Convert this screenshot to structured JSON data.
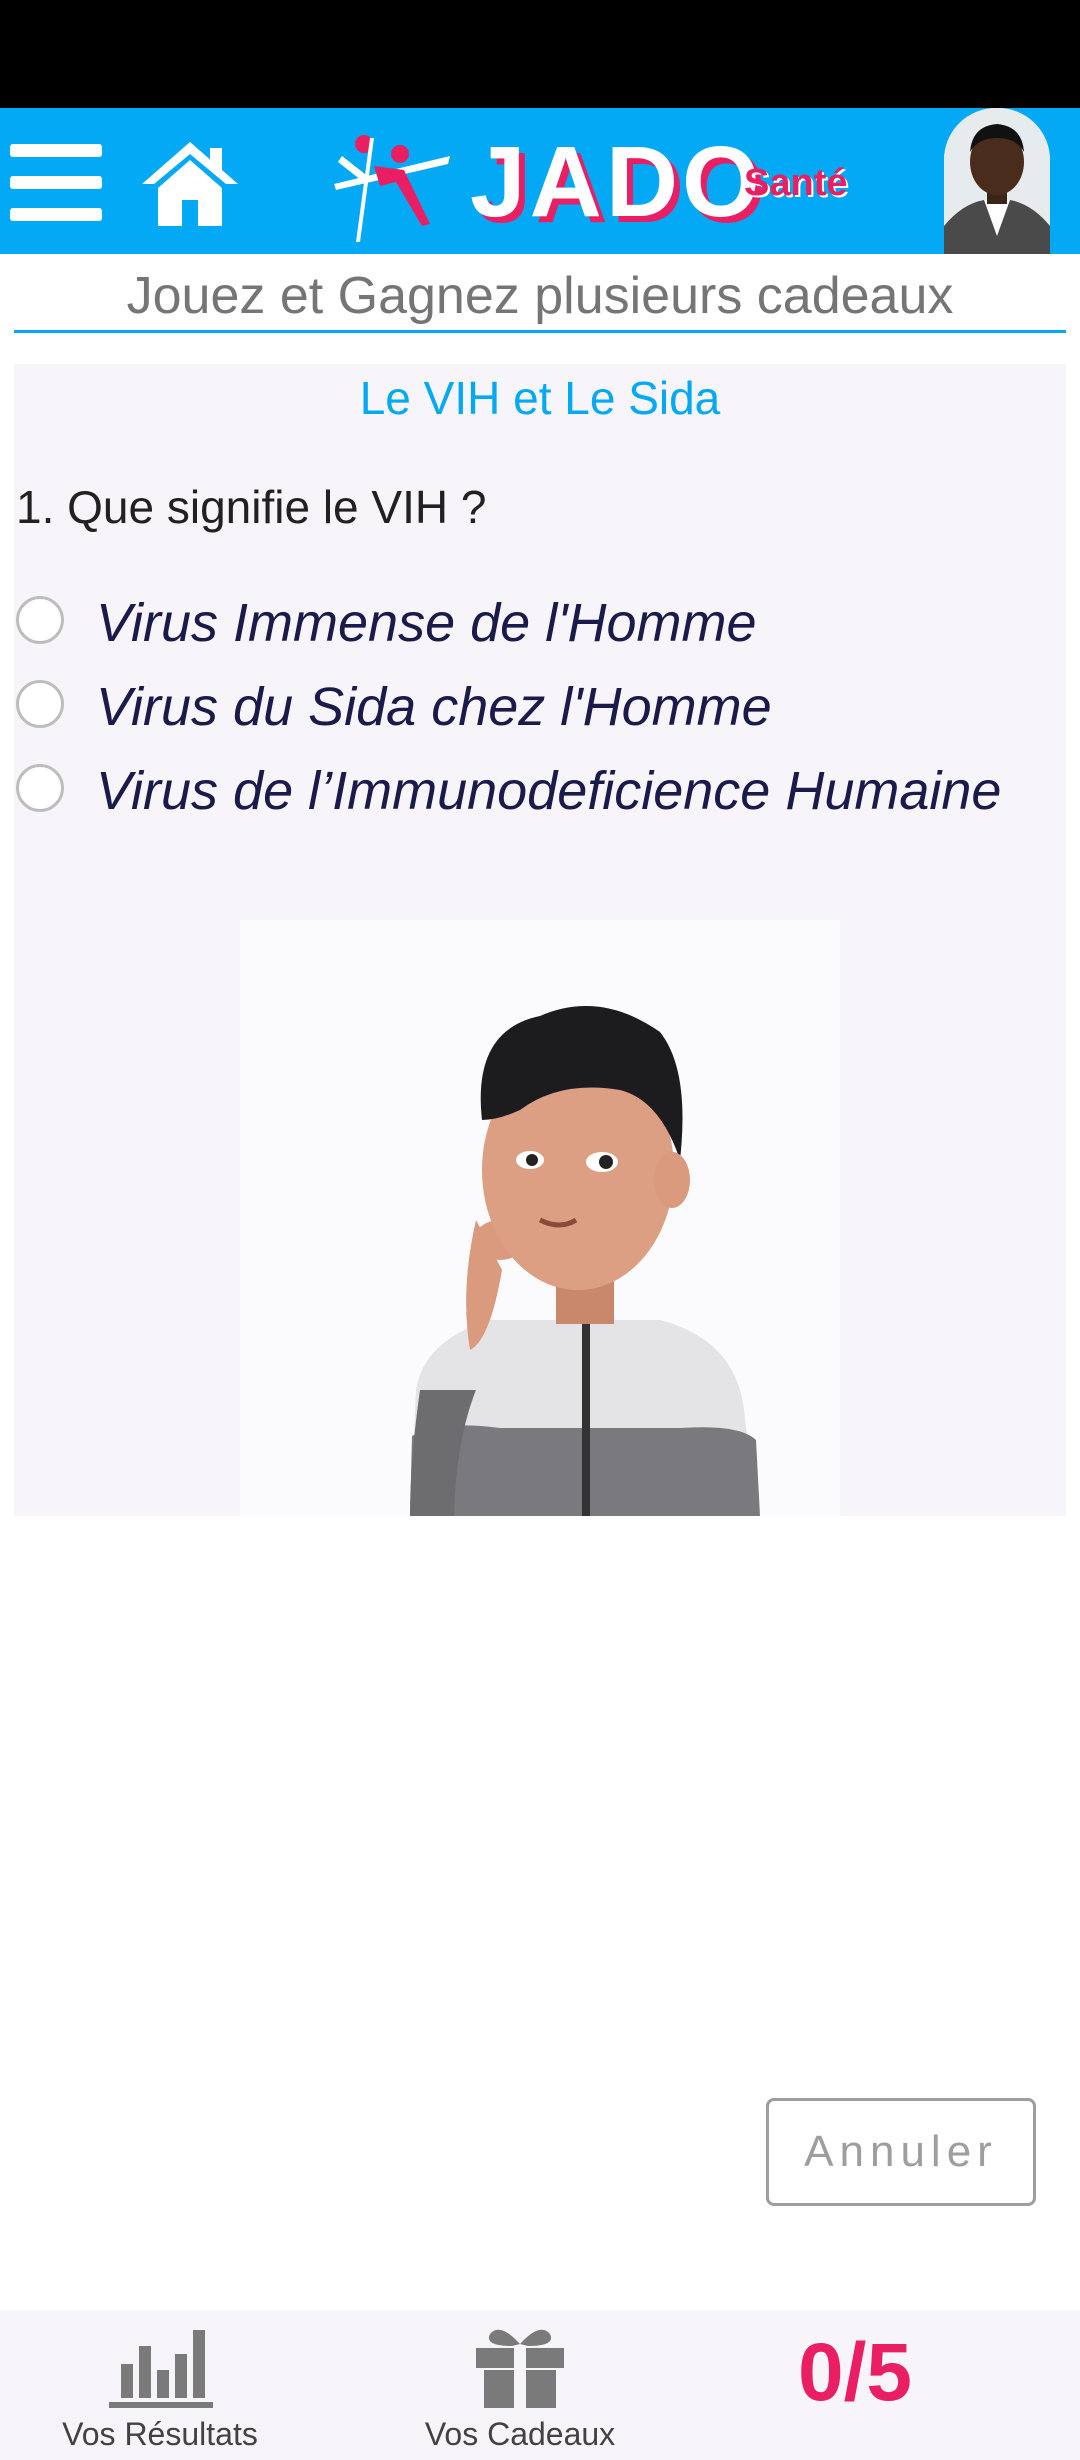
{
  "header": {
    "brand_name": "JADO",
    "brand_sub": "Santé",
    "menu_icon": "hamburger-icon",
    "home_icon": "home-icon",
    "accent_color": "#03a9f4",
    "brand_color": "#e91e63"
  },
  "banner": {
    "text": "Jouez et Gagnez plusieurs cadeaux"
  },
  "quiz": {
    "title": "Le VIH et Le Sida",
    "question": "1. Que signifie le VIH ?",
    "options": [
      {
        "label": "Virus Immense de l'Homme"
      },
      {
        "label": "Virus du Sida chez l'Homme"
      },
      {
        "label": "Virus de l’Immunodeficience Humaine"
      }
    ]
  },
  "actions": {
    "cancel_label": "Annuler"
  },
  "bottom_nav": {
    "results_label": "Vos Résultats",
    "results_icon": "bar-chart-icon",
    "gifts_label": "Vos Cadeaux",
    "gifts_icon": "gift-icon",
    "score": "0/5"
  }
}
